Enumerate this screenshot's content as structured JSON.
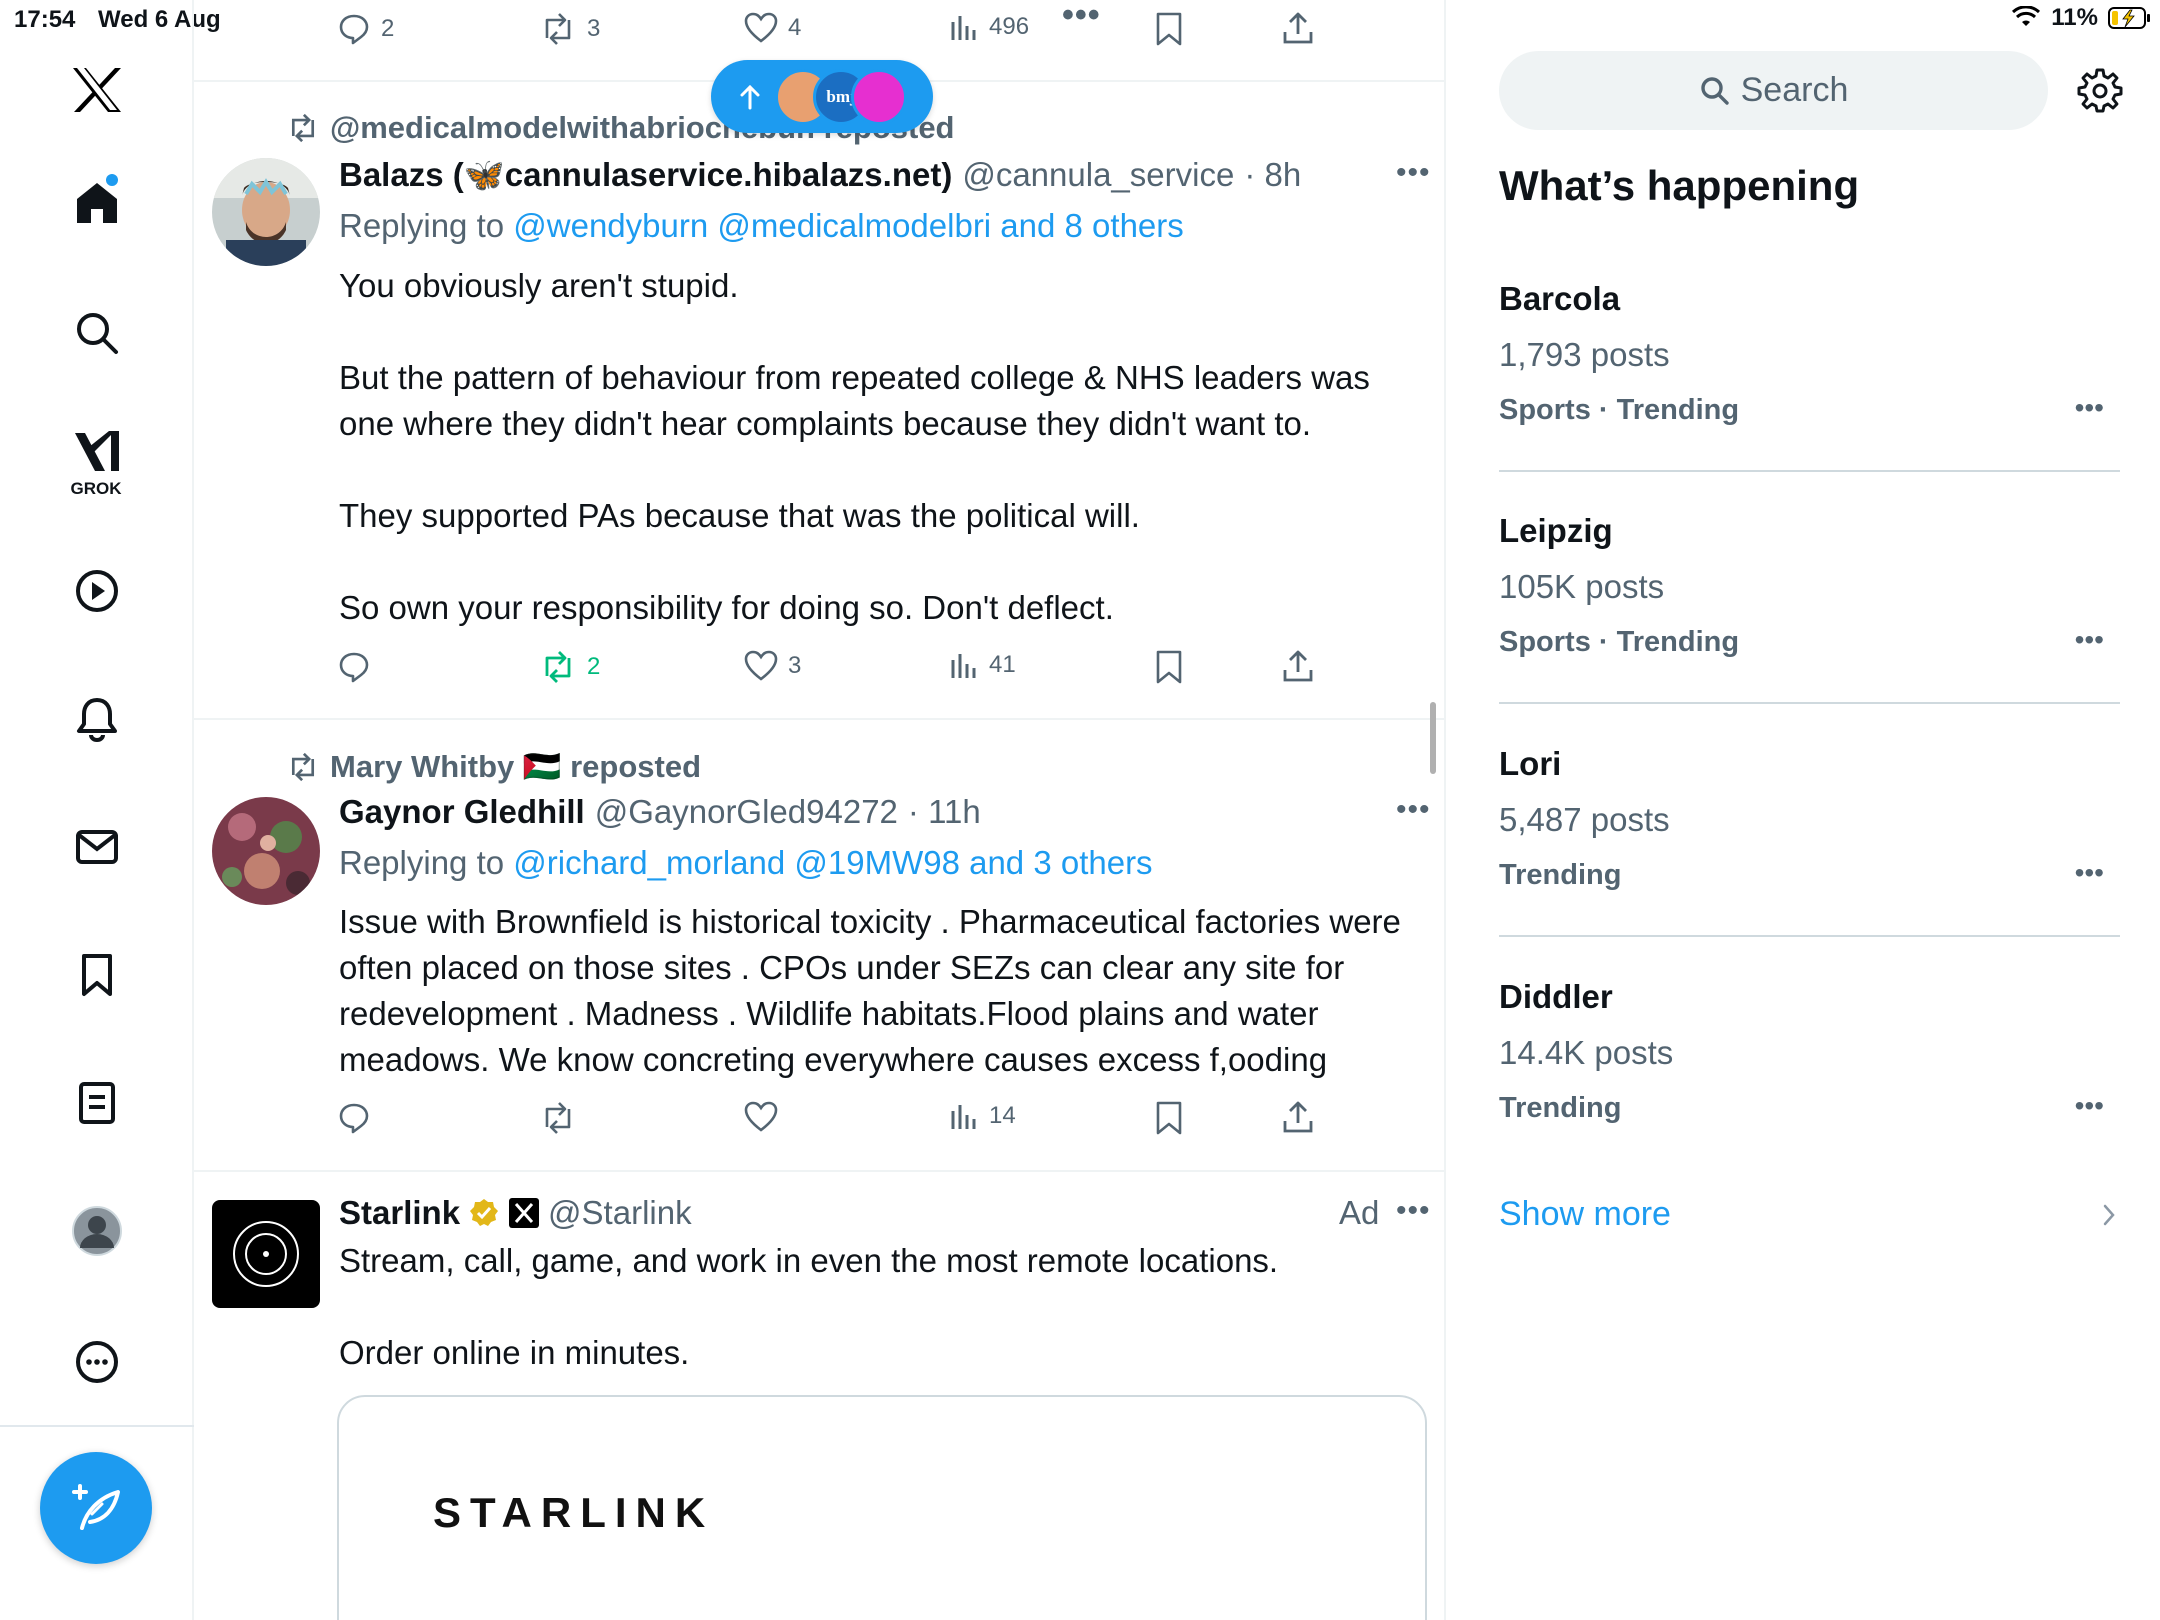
{
  "status_bar": {
    "time": "17:54",
    "date": "Wed 6 Aug",
    "battery": "11%"
  },
  "nav": {
    "grok_label": "GROK",
    "items": [
      "x-logo",
      "home",
      "explore",
      "grok",
      "video",
      "notifications",
      "messages",
      "bookmarks",
      "lists",
      "profile",
      "more"
    ]
  },
  "top_actions": {
    "replies": "2",
    "reposts": "3",
    "likes": "4",
    "views": "496"
  },
  "tweets": [
    {
      "reposted_by": "@medicalmodelwithabriochebun reposted",
      "name": "Balazs (🦋cannulaservice.hibalazs.net)",
      "handle": "@cannula_service",
      "time": "· 8h",
      "replying_prefix": "Replying to ",
      "replying_to": "@wendyburn @medicalmodelbri and 8 others",
      "body": "You obviously aren't stupid.\n\nBut the pattern of behaviour from repeated college & NHS leaders was one where they didn't hear complaints because they didn't want to.\n\nThey supported PAs because that was the political will.\n\nSo own your responsibility for doing so. Don't deflect.",
      "replies": "",
      "reposts": "2",
      "likes": "3",
      "views": "41"
    },
    {
      "reposted_by": "Mary Whitby 🇵🇸 reposted",
      "name": "Gaynor Gledhill",
      "handle": "@GaynorGled94272",
      "time": "· 11h",
      "replying_prefix": "Replying to ",
      "replying_to": "@richard_morland @19MW98 and 3 others",
      "body": "Issue with Brownfield is historical toxicity . Pharmaceutical factories were often placed on those sites . CPOs under SEZs can clear any site for redevelopment . Madness . Wildlife habitats.Flood plains and water meadows. We know concreting everywhere causes excess f,ooding",
      "replies": "",
      "reposts": "",
      "likes": "",
      "views": "14"
    }
  ],
  "ad": {
    "name": "Starlink",
    "handle": "@Starlink",
    "ad_label": "Ad",
    "body": "Stream, call, game, and work in even the most remote locations.\n\nOrder online in minutes.",
    "card_logo": "STARLINK"
  },
  "pill": {
    "label": "bmj"
  },
  "sidebar": {
    "search_placeholder": "Search",
    "title": "What’s happening",
    "trends": [
      {
        "name": "Barcola",
        "posts": "1,793 posts",
        "meta": "Sports · Trending"
      },
      {
        "name": "Leipzig",
        "posts": "105K posts",
        "meta": "Sports · Trending"
      },
      {
        "name": "Lori",
        "posts": "5,487 posts",
        "meta": "Trending"
      },
      {
        "name": "Diddler",
        "posts": "14.4K posts",
        "meta": "Trending"
      }
    ],
    "show_more": "Show more"
  },
  "colors": {
    "accent": "#1d9bf0",
    "repost_green": "#00ba7c",
    "muted": "#536471"
  }
}
